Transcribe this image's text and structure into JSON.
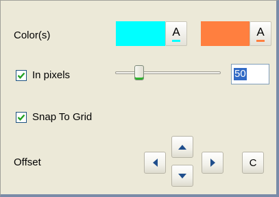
{
  "colors": {
    "label": "Color(s)",
    "items": [
      {
        "fill": "#00ffff",
        "font_button_label": "A",
        "font_bar": "#00ffff"
      },
      {
        "fill": "#ff7f3f",
        "font_button_label": "A",
        "font_bar": "#ff7f3f"
      }
    ]
  },
  "in_pixels": {
    "label": "In pixels",
    "checked": true,
    "value": "50",
    "slider_fraction": 0.25
  },
  "snap_to_grid": {
    "label": "Snap To Grid",
    "checked": true
  },
  "offset": {
    "label": "Offset",
    "up_icon": "arrow-up-icon",
    "down_icon": "arrow-down-icon",
    "left_icon": "arrow-left-icon",
    "right_icon": "arrow-right-icon",
    "center_label": "C"
  },
  "theme": {
    "background": "#ece9d8",
    "check_color": "#21a121",
    "arrow_color": "#1f4e8c",
    "selection": "#316ac5"
  }
}
